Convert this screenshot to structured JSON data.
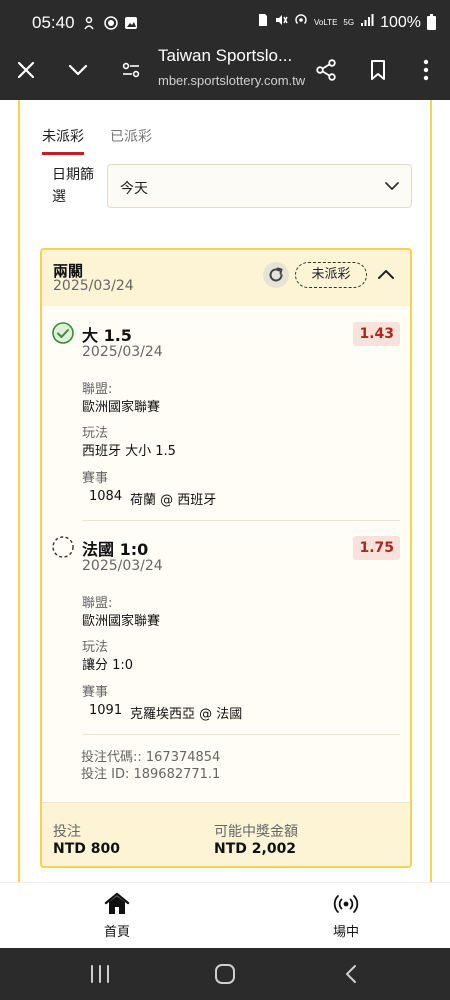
{
  "status_bar": {
    "time": "05:40",
    "battery": "100%",
    "volte": "VoLTE",
    "network": "5G"
  },
  "browser": {
    "title": "Taiwan Sportslo...",
    "url": "mber.sportslottery.com.tw"
  },
  "tabs": [
    {
      "label": "未派彩",
      "active": true
    },
    {
      "label": "已派彩",
      "active": false
    }
  ],
  "filter": {
    "label": "日期篩選",
    "value": "今天"
  },
  "ticket": {
    "title": "兩關",
    "date": "2025/03/24",
    "status": "未派彩",
    "selections": [
      {
        "name": "大 1.5",
        "date": "2025/03/24",
        "odds": "1.43",
        "settled": true,
        "league_label": "聯盟:",
        "league": "歐洲國家聯賽",
        "play_label": "玩法",
        "play": "西班牙 大小 1.5",
        "event_label": "賽事",
        "event_no": "1084",
        "event_name": "荷蘭 @ 西班牙"
      },
      {
        "name": "法國 1:0",
        "date": "2025/03/24",
        "odds": "1.75",
        "settled": false,
        "league_label": "聯盟:",
        "league": "歐洲國家聯賽",
        "play_label": "玩法",
        "play": "讓分 1:0",
        "event_label": "賽事",
        "event_no": "1091",
        "event_name": "克羅埃西亞 @ 法國"
      }
    ],
    "bet_code": "投注代碼:: 167374854",
    "bet_id": "投注 ID: 189682771.1",
    "stake_label": "投注",
    "stake": "NTD 800",
    "payout_label": "可能中獎金額",
    "payout": "NTD 2,002"
  },
  "bottom_nav": [
    {
      "label": "首頁",
      "icon": "home-icon"
    },
    {
      "label": "場中",
      "icon": "live-signal-icon"
    }
  ],
  "colors": {
    "accent_yellow": "#f5d34a",
    "header_bg": "#fdf4d6",
    "tab_underline": "#c51f1f",
    "odds_text": "#b1261d",
    "odds_bg": "#f8e3dc",
    "check_green": "#3a8a3a"
  }
}
